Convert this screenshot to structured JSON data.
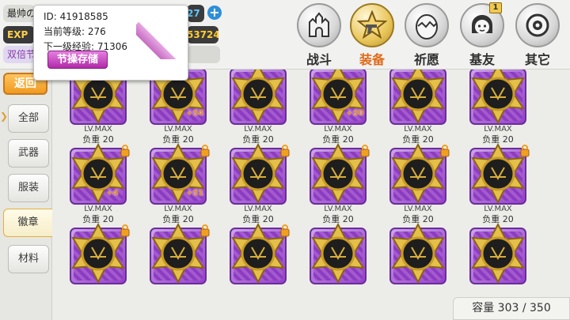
{
  "player": {
    "name": "最帅の",
    "exp_label": "EXP",
    "double_label": "双倍节",
    "currency1": "27",
    "currency2": "53724"
  },
  "popup": {
    "id_line": "ID: 41918585",
    "level_line": "当前等级: 276",
    "next_exp_line": "下一级经验: 71306",
    "save_button": "节操存储"
  },
  "tabs": [
    {
      "label": "战斗",
      "icon": "castle-icon",
      "active": false
    },
    {
      "label": "装备",
      "icon": "star-gun-icon",
      "active": true
    },
    {
      "label": "祈愿",
      "icon": "egg-icon",
      "active": false
    },
    {
      "label": "基友",
      "icon": "friend-face-icon",
      "active": false,
      "badge": "1"
    },
    {
      "label": "其它",
      "icon": "gear-dial-icon",
      "active": false
    }
  ],
  "sidebar": {
    "back": "返回",
    "categories": [
      {
        "label": "全部",
        "active": false
      },
      {
        "label": "武器",
        "active": false
      },
      {
        "label": "服装",
        "active": false
      },
      {
        "label": "徽章",
        "active": true
      },
      {
        "label": "材料",
        "active": false
      }
    ]
  },
  "items": [
    {
      "level": "LV.MAX",
      "weight": "负重 20",
      "plus": "",
      "locked": false
    },
    {
      "level": "LV.MAX",
      "weight": "负重 20",
      "plus": "+54",
      "locked": false
    },
    {
      "level": "LV.MAX",
      "weight": "负重 20",
      "plus": "",
      "locked": false
    },
    {
      "level": "LV.MAX",
      "weight": "负重 20",
      "plus": "+30",
      "locked": false
    },
    {
      "level": "LV.MAX",
      "weight": "负重 20",
      "plus": "",
      "locked": false
    },
    {
      "level": "LV.MAX",
      "weight": "负重 20",
      "plus": "",
      "locked": false
    },
    {
      "level": "LV.MAX",
      "weight": "负重 20",
      "plus": "+4",
      "locked": true
    },
    {
      "level": "LV.MAX",
      "weight": "负重 20",
      "plus": "+51",
      "locked": true
    },
    {
      "level": "LV.MAX",
      "weight": "负重 20",
      "plus": "",
      "locked": true
    },
    {
      "level": "LV.MAX",
      "weight": "负重 20",
      "plus": "",
      "locked": true
    },
    {
      "level": "LV.MAX",
      "weight": "负重 20",
      "plus": "",
      "locked": true
    },
    {
      "level": "LV.MAX",
      "weight": "负重 20",
      "plus": "",
      "locked": true
    },
    {
      "level": "",
      "weight": "",
      "plus": "",
      "locked": true
    },
    {
      "level": "",
      "weight": "",
      "plus": "",
      "locked": true
    },
    {
      "level": "",
      "weight": "",
      "plus": "",
      "locked": true
    },
    {
      "level": "",
      "weight": "",
      "plus": "",
      "locked": false
    },
    {
      "level": "",
      "weight": "",
      "plus": "",
      "locked": false
    },
    {
      "level": "",
      "weight": "",
      "plus": "",
      "locked": false
    }
  ],
  "capacity": "容量 303 / 350",
  "colors": {
    "accent": "#e06a18",
    "badge_frame": "#9440c8",
    "gold": "#d4a82c"
  }
}
